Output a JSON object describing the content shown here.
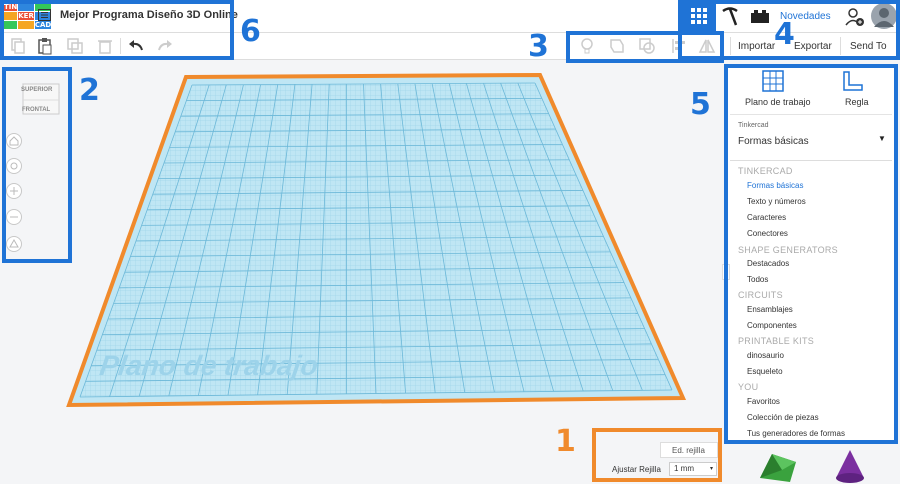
{
  "app": {
    "logo_letters": [
      "TIN",
      "KER",
      "CAD"
    ],
    "document_title": "Mejor Programa Diseño 3D Online"
  },
  "header": {
    "novedades_label": "Novedades",
    "import_label": "Importar",
    "export_label": "Exportar",
    "send_to_label": "Send To"
  },
  "viewcube": {
    "top_label": "SUPERIOR",
    "front_label": "FRONTAL"
  },
  "workplane": {
    "label": "Plano de trabajo"
  },
  "panel": {
    "workplane_button_label": "Plano de trabajo",
    "ruler_button_label": "Regla",
    "category_caption": "Tinkercad",
    "category_value": "Formas básicas",
    "sections": [
      {
        "title": "TINKERCAD",
        "items": [
          "Formas básicas",
          "Texto y números",
          "Caracteres",
          "Conectores"
        ]
      },
      {
        "title": "SHAPE GENERATORS",
        "items": [
          "Destacados",
          "Todos"
        ]
      },
      {
        "title": "CIRCUITS",
        "items": [
          "Ensamblajes",
          "Componentes"
        ]
      },
      {
        "title": "PRINTABLE KITS",
        "items": [
          "dinosaurio",
          "Esqueleto"
        ]
      },
      {
        "title": "YOU",
        "items": [
          "Favoritos",
          "Colección de piezas",
          "Tus generadores de formas"
        ]
      }
    ]
  },
  "grid_settings": {
    "edit_grid_label": "Ed. rejilla",
    "snap_grid_label": "Ajustar Rejilla",
    "snap_grid_value": "1 mm"
  },
  "annotations": {
    "labels": [
      "1",
      "2",
      "3",
      "4",
      "5",
      "6"
    ],
    "blue_color": "#1f73d6",
    "orange_color": "#f08a2c"
  },
  "colors": {
    "accent": "#1f73d6",
    "grid_blue": "#a8d8ec",
    "green_shape": "#3aa23e",
    "purple_shape": "#7b2fa0"
  }
}
